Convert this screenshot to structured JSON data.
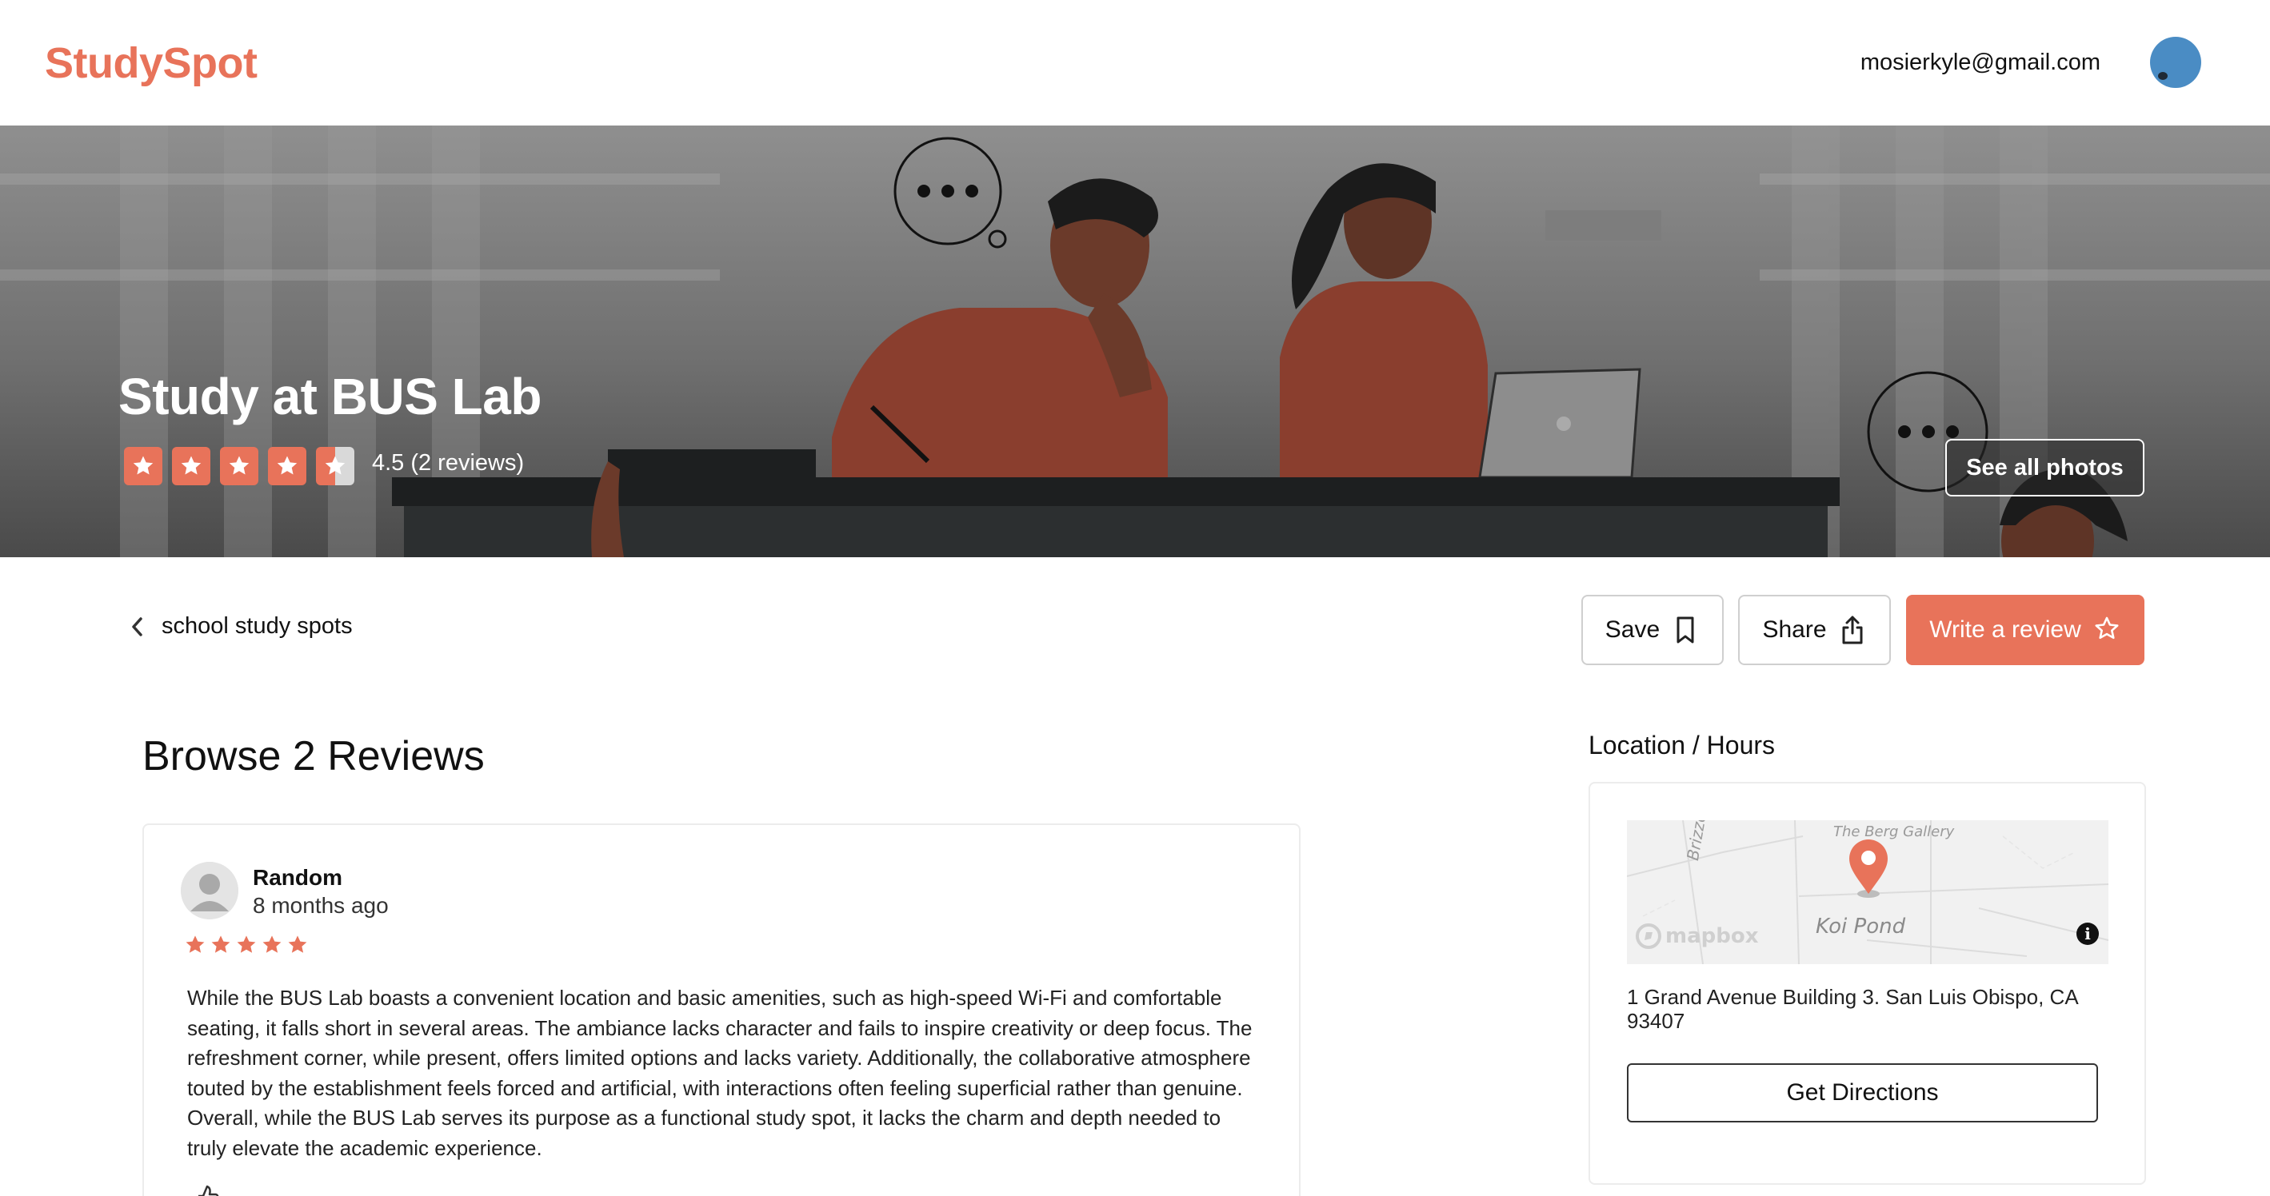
{
  "header": {
    "logo": "StudySpot",
    "user_email": "mosierkyle@gmail.com"
  },
  "hero": {
    "title": "Study at BUS Lab",
    "rating": 4.5,
    "rating_text": "4.5",
    "reviews_text": "(2 reviews)",
    "see_all_photos": "See all photos"
  },
  "nav": {
    "back_label": "school study spots"
  },
  "actions": {
    "save": "Save",
    "share": "Share",
    "write_review": "Write a review"
  },
  "reviews": {
    "title": "Browse 2 Reviews",
    "items": [
      {
        "name": "Random",
        "time": "8 months ago",
        "stars": 5,
        "text": "While the BUS Lab boasts a convenient location and basic amenities, such as high-speed Wi-Fi and comfortable seating, it falls short in several areas. The ambiance lacks character and fails to inspire creativity or deep focus. The refreshment corner, while present, offers limited options and lacks variety. Additionally, the collaborative atmosphere touted by the establishment feels forced and artificial, with interactions often feeling superficial rather than genuine. Overall, while the BUS Lab serves its purpose as a functional study spot, it lacks the charm and depth needed to truly elevate the academic experience."
      }
    ]
  },
  "location": {
    "title": "Location / Hours",
    "map": {
      "street_label": "Brizzolare",
      "gallery_label": "The Berg Gallery",
      "pond_label": "Koi Pond",
      "attribution": "mapbox"
    },
    "address": "1 Grand Avenue Building 3. San Luis Obispo, CA 93407",
    "directions_button": "Get Directions"
  },
  "colors": {
    "brand": "#E8735A",
    "avatar": "#4A8CC4"
  }
}
